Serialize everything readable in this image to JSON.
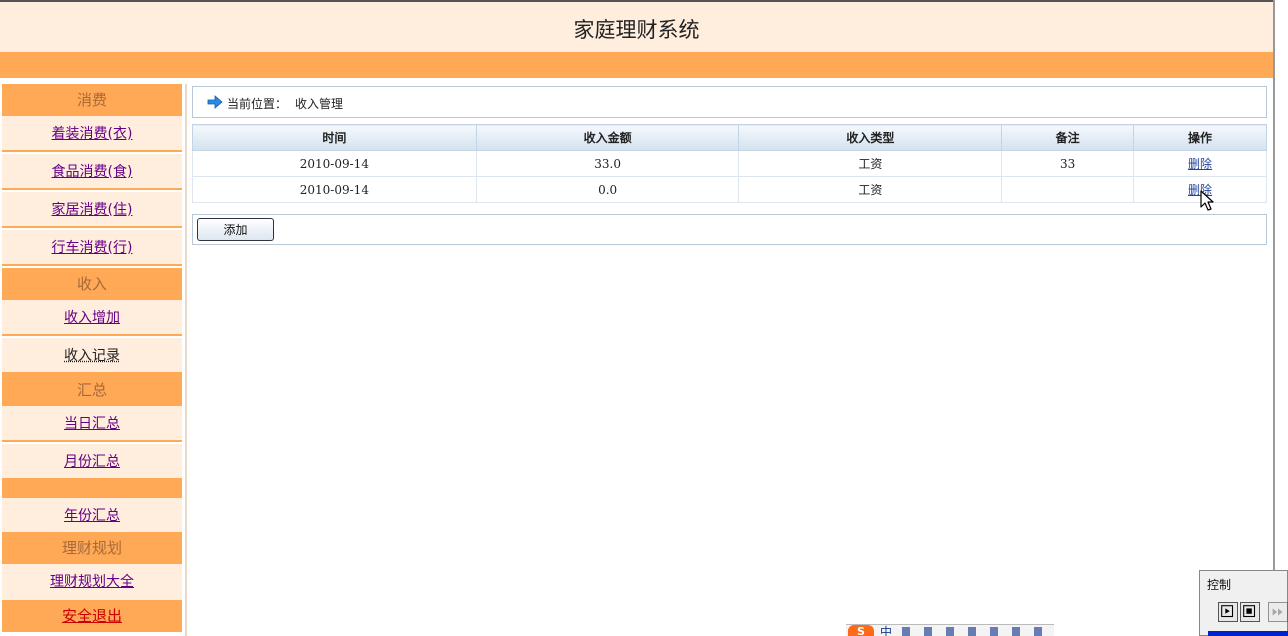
{
  "header": {
    "title": "家庭理财系统"
  },
  "sidebar": {
    "sections": [
      {
        "heading": "消费",
        "items": [
          "着装消费(衣)",
          "食品消费(食)",
          "家居消费(住)",
          "行车消费(行)"
        ]
      },
      {
        "heading": "收入",
        "items": [
          "收入增加",
          "收入记录"
        ]
      },
      {
        "heading": "汇总",
        "items": [
          "当日汇总",
          "月份汇总",
          "年份汇总"
        ]
      },
      {
        "heading": "理财规划",
        "items": [
          "理财规划大全"
        ]
      }
    ],
    "logout": "安全退出"
  },
  "breadcrumb": {
    "label": "当前位置：",
    "current": "收入管理"
  },
  "table": {
    "columns": [
      "时间",
      "收入金额",
      "收入类型",
      "备注",
      "操作"
    ],
    "rows": [
      {
        "date": "2010-09-14",
        "amount": "33.0",
        "type": "工资",
        "note": "33",
        "action": "删除"
      },
      {
        "date": "2010-09-14",
        "amount": "0.0",
        "type": "工资",
        "note": "",
        "action": "删除"
      }
    ]
  },
  "add_button": "添加",
  "control_panel": {
    "title": "控制"
  },
  "ime": {
    "logo": "S",
    "lang": "中"
  },
  "colors": {
    "header_bg": "#ffeedd",
    "accent_orange": "#ffa855",
    "link_purple": "#660088",
    "logout_red": "#cc0000",
    "control_bar": "#0022cc"
  }
}
